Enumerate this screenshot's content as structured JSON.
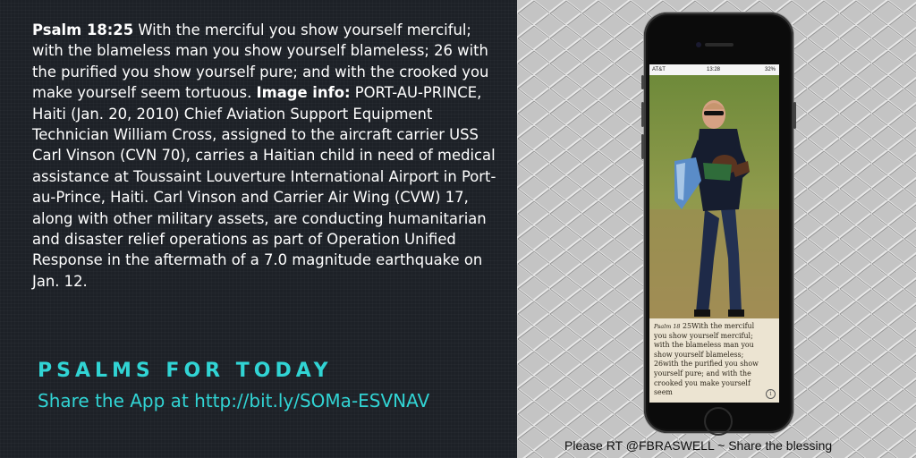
{
  "verse": {
    "ref_label": "Psalm 18:25",
    "text": " With the merciful you show yourself merciful; with the blameless man you show yourself blameless; 26 with the purified you show yourself pure; and with the crooked you make yourself seem tortuous.",
    "info_label": "Image info:",
    "info_text": " PORT-AU-PRINCE, Haiti (Jan. 20, 2010) Chief Aviation Support Equipment Technician William Cross, assigned to the aircraft carrier USS Carl Vinson (CVN 70), carries a Haitian child in need of medical assistance at Toussaint Louverture International Airport in Port-au-Prince, Haiti. Carl Vinson and Carrier Air Wing (CVW) 17, along with other military assets, are conducting humanitarian and disaster relief operations as part of Operation Unified Response in the aftermath of a 7.0 magnitude earthquake on Jan. 12."
  },
  "brand": {
    "title": "PSALMS FOR TODAY",
    "share": "Share the App at  http://bit.ly/SOMa-ESVNAV"
  },
  "phone": {
    "status_left": "AT&T",
    "status_time": "13:28",
    "status_right": "32%",
    "caption_ref": "Psalm 18",
    "caption_text": "25With the merciful you show yourself merciful; with the blameless man you show yourself blameless; 26with the purified you show yourself pure; and with the crooked you make yourself seem",
    "info_icon": "i"
  },
  "footer": {
    "retweet": "Please RT @FBRASWELL ~ Share the blessing"
  },
  "colors": {
    "accent": "#31d4d4",
    "panel_dark": "#1d2127",
    "panel_light": "#c4c4c4"
  }
}
